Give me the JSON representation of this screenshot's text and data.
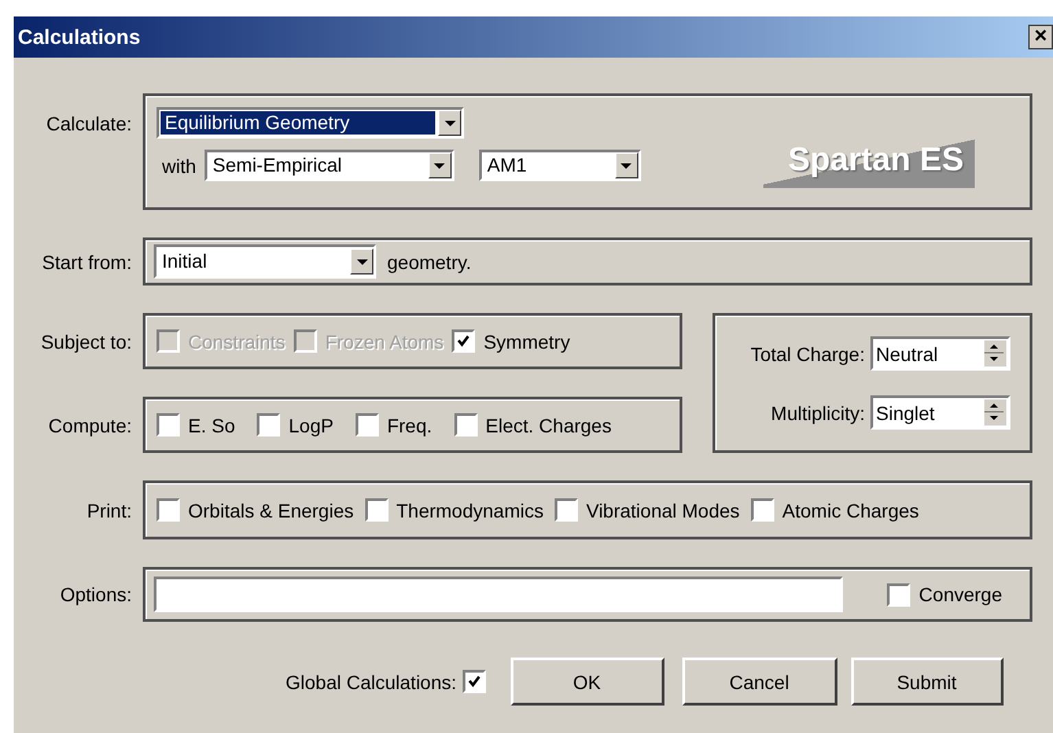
{
  "window": {
    "title": "Calculations",
    "close": "×"
  },
  "calculate": {
    "label": "Calculate:",
    "task": {
      "value": "Equilibrium Geometry",
      "focused": true
    },
    "with_label": "with",
    "method": "Semi-Empirical",
    "model": "AM1"
  },
  "logo": "Spartan ES",
  "start_from": {
    "label": "Start from:",
    "value": "Initial",
    "suffix": "geometry."
  },
  "subject_to": {
    "label": "Subject to:",
    "options": [
      {
        "label": "Constraints",
        "checked": false,
        "disabled": true
      },
      {
        "label": "Frozen Atoms",
        "checked": false,
        "disabled": true
      },
      {
        "label": "Symmetry",
        "checked": true,
        "disabled": false
      }
    ]
  },
  "compute": {
    "label": "Compute:",
    "options": [
      {
        "label": "E. So",
        "checked": false,
        "disabled": false
      },
      {
        "label": "LogP",
        "checked": false,
        "disabled": false
      },
      {
        "label": "Freq.",
        "checked": false,
        "disabled": false
      },
      {
        "label": "Elect. Charges",
        "checked": false,
        "disabled": false
      }
    ]
  },
  "charge": {
    "label": "Total Charge:",
    "value": "Neutral"
  },
  "multiplicity": {
    "label": "Multiplicity:",
    "value": "Singlet"
  },
  "print": {
    "label": "Print:",
    "options": [
      {
        "label": "Orbitals & Energies",
        "checked": false,
        "disabled": false
      },
      {
        "label": "Thermodynamics",
        "checked": false,
        "disabled": false
      },
      {
        "label": "Vibrational Modes",
        "checked": false,
        "disabled": false
      },
      {
        "label": "Atomic Charges",
        "checked": false,
        "disabled": false
      }
    ]
  },
  "options": {
    "label": "Options:",
    "converge": {
      "label": "Converge",
      "checked": false
    }
  },
  "global": {
    "label": "Global Calculations:",
    "checked": true
  },
  "buttons": [
    "OK",
    "Cancel",
    "Submit"
  ]
}
